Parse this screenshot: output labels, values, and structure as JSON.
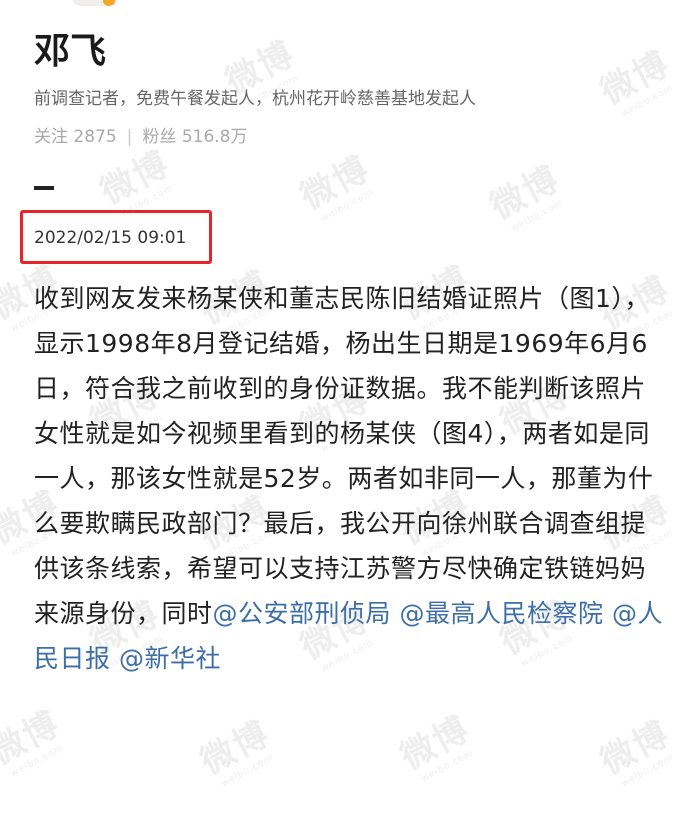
{
  "profile": {
    "name": "邓飞",
    "bio": "前调查记者，免费午餐发起人，杭州花开岭慈善基地发起人",
    "following_label": "关注",
    "following_count": "2875",
    "stats_separator": "|",
    "followers_label": "粉丝",
    "followers_count": "516.8万"
  },
  "post": {
    "timestamp": "2022/02/15 09:01",
    "body": "收到网友发来杨某侠和董志民陈旧结婚证照片（图1），显示1998年8月登记结婚，杨出生日期是1969年6月6日，符合我之前收到的身份证数据。我不能判断该照片女性就是如今视频里看到的杨某侠（图4），两者如是同一人，那该女性就是52岁。两者如非同一人，那董为什么要欺瞒民政部门？最后，我公开向徐州联合调查组提供该条线索，希望可以支持江苏警方尽快确定铁链妈妈来源身份，同时",
    "mentions": [
      "@公安部刑侦局",
      "@最高人民检察院",
      "@人民日报",
      "@新华社"
    ]
  },
  "watermark": {
    "text": "微博",
    "subtext": "weibo.com"
  },
  "colors": {
    "mention": "#3d6ea6",
    "highlight_box": "#e8232a"
  }
}
